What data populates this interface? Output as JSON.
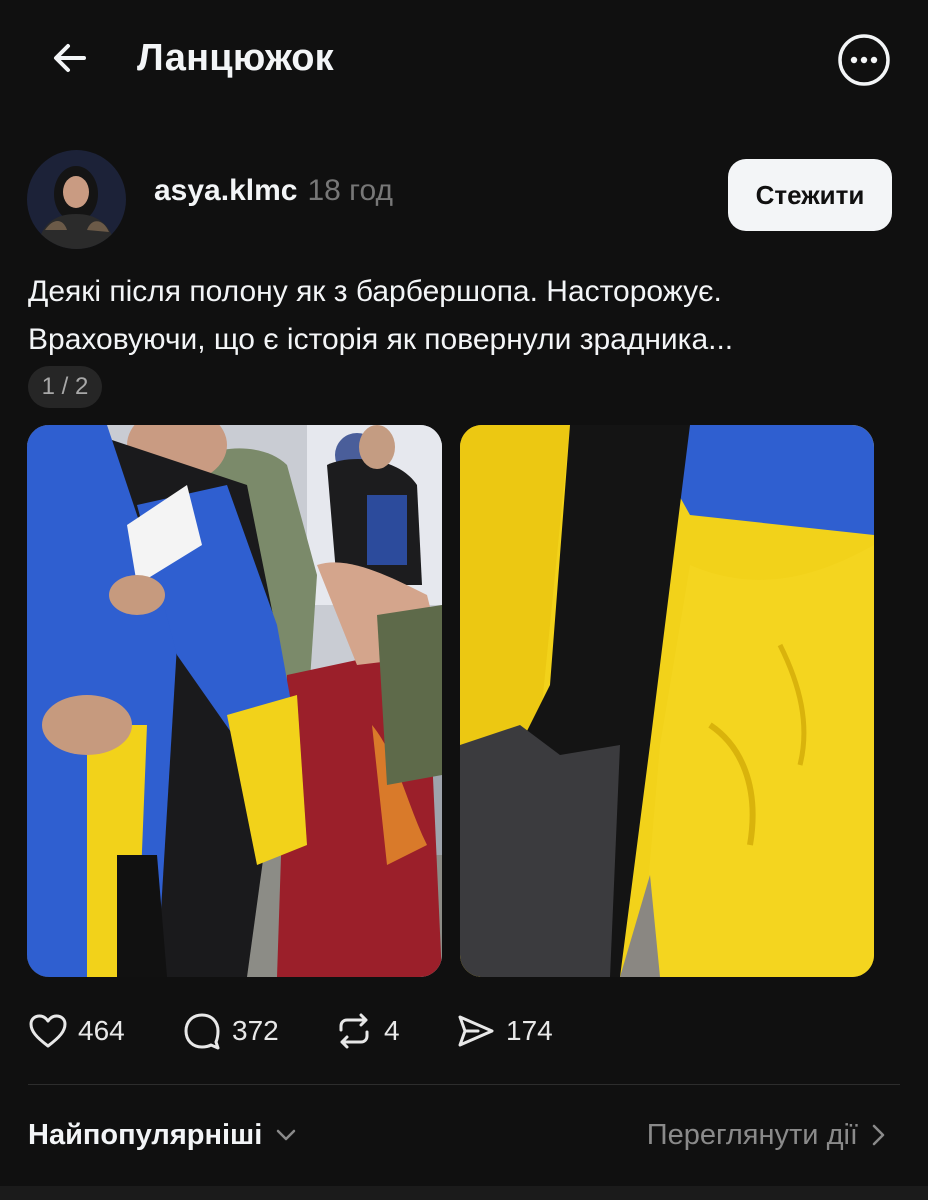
{
  "header": {
    "title": "Ланцюжок",
    "back_icon": "arrow-left-icon",
    "more_icon": "more-circle-icon"
  },
  "post": {
    "username": "asya.klmc",
    "time": "18 год",
    "follow_label": "Стежити",
    "text": "Деякі після полону як з барбершопа. Насторожує.\nВраховуючи, що є історія як повернули зрадника...",
    "page_indicator": "1 / 2",
    "stats": {
      "likes": "464",
      "comments": "372",
      "reposts": "4",
      "shares": "174"
    }
  },
  "footer": {
    "sort_label": "Найпопулярніші",
    "view_activity_label": "Переглянути дії"
  },
  "colors": {
    "background": "#101010",
    "text": "#f3f5f7",
    "muted": "#777777",
    "flag_blue": "#2f5fd0",
    "flag_yellow": "#f2d21a"
  }
}
